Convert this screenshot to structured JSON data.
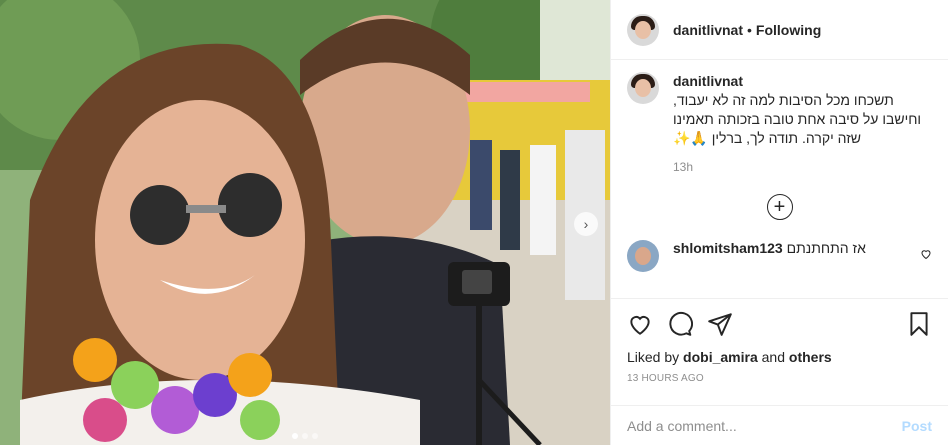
{
  "photo": {
    "alt": "",
    "slides": 3,
    "active_slide": 1
  },
  "header": {
    "username": "danitlivnat",
    "separator": "•",
    "follow_status": "Following"
  },
  "caption": {
    "username": "danitlivnat",
    "text": "תשכחו מכל הסיבות למה זה לא יעבוד, וחישבו על סיבה אחת טובה בזכותה תאמינו שזה יקרה. תודה לך, ברלין 🙏✨",
    "time": "13h"
  },
  "load_more": "+",
  "comments": [
    {
      "username": "shlomitsham123",
      "text": "אז התחתנתם"
    }
  ],
  "engagement": {
    "liked_by_prefix": "Liked by ",
    "liked_by_user": "dobi_amira",
    "liked_by_and": " and ",
    "liked_by_others": "others",
    "timestamp": "13 HOURS AGO"
  },
  "add_comment": {
    "placeholder": "Add a comment...",
    "post_label": "Post"
  },
  "colors": {
    "text": "#262626",
    "muted": "#8e8e8e",
    "border": "#efefef",
    "post_disabled": "#b3dbff"
  }
}
